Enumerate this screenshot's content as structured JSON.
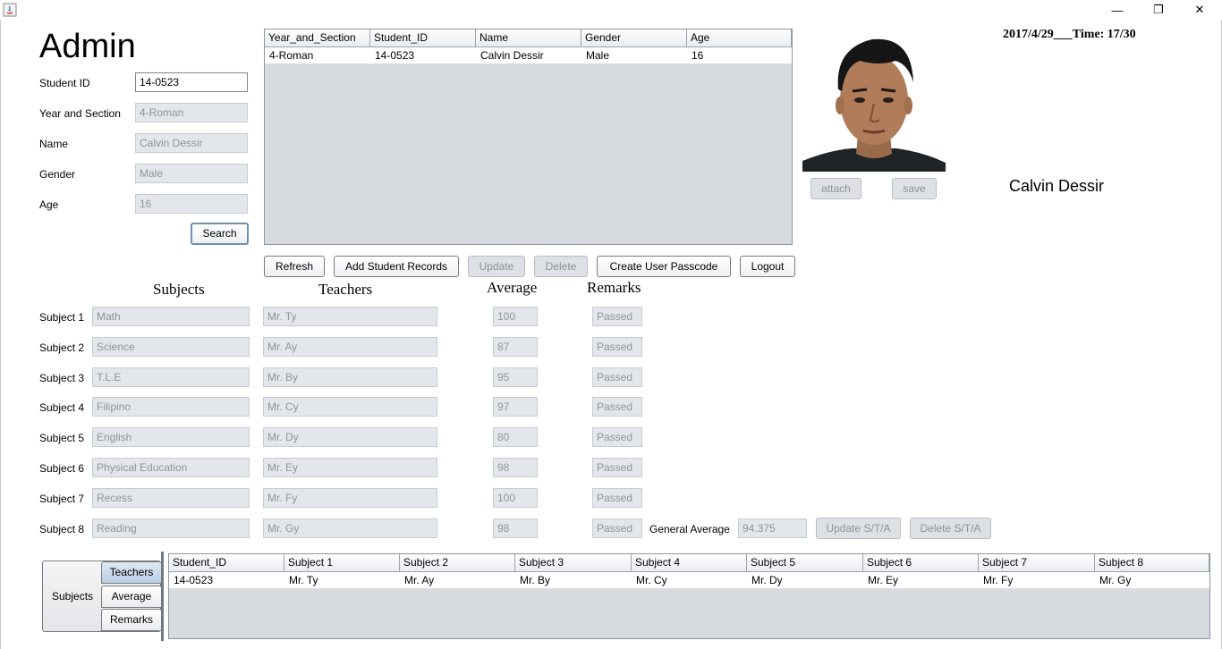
{
  "window": {
    "minimize": "—",
    "restore": "❐",
    "close": "✕"
  },
  "header": {
    "title": "Admin",
    "datetime": "2017/4/29___Time: 17/30"
  },
  "form": {
    "student_id_label": "Student ID",
    "student_id_value": "14-0523",
    "year_section_label": "Year and Section",
    "year_section_value": "4-Roman",
    "name_label": "Name",
    "name_value": "Calvin Dessir",
    "gender_label": "Gender",
    "gender_value": "Male",
    "age_label": "Age",
    "age_value": "16",
    "search_label": "Search"
  },
  "students_table": {
    "columns": [
      "Year_and_Section",
      "Student_ID",
      "Name",
      "Gender",
      "Age"
    ],
    "rows": [
      [
        "4-Roman",
        "14-0523",
        "Calvin Dessir",
        "Male",
        "16"
      ]
    ]
  },
  "actions": {
    "refresh": "Refresh",
    "add": "Add Student Records",
    "update": "Update",
    "delete": "Delete",
    "passcode": "Create User Passcode",
    "logout": "Logout"
  },
  "photo": {
    "attach": "attach",
    "save": "save",
    "student_name": "Calvin Dessir"
  },
  "grades": {
    "headers": {
      "subjects": "Subjects",
      "teachers": "Teachers",
      "average": "Average",
      "remarks": "Remarks"
    },
    "rows": [
      {
        "label": "Subject 1",
        "subject": "Math",
        "teacher": "Mr. Ty",
        "average": "100",
        "remarks": "Passed"
      },
      {
        "label": "Subject 2",
        "subject": "Science",
        "teacher": "Mr. Ay",
        "average": "87",
        "remarks": "Passed"
      },
      {
        "label": "Subject 3",
        "subject": "T.L.E",
        "teacher": "Mr. By",
        "average": "95",
        "remarks": "Passed"
      },
      {
        "label": "Subject 4",
        "subject": "Filipino",
        "teacher": "Mr. Cy",
        "average": "97",
        "remarks": "Passed"
      },
      {
        "label": "Subject 5",
        "subject": "English",
        "teacher": "Mr. Dy",
        "average": "80",
        "remarks": "Passed"
      },
      {
        "label": "Subject 6",
        "subject": "Physical Education",
        "teacher": "Mr. Ey",
        "average": "98",
        "remarks": "Passed"
      },
      {
        "label": "Subject 7",
        "subject": "Recess",
        "teacher": "Mr. Fy",
        "average": "100",
        "remarks": "Passed"
      },
      {
        "label": "Subject 8",
        "subject": "Reading",
        "teacher": "Mr. Gy",
        "average": "98",
        "remarks": "Passed"
      }
    ],
    "general_average_label": "General Average",
    "general_average_value": "94.375",
    "update_sta": "Update S/T/A",
    "delete_sta": "Delete S/T/A"
  },
  "bottom_tabs": {
    "outer": "Subjects",
    "inner": [
      "Teachers",
      "Average",
      "Remarks"
    ]
  },
  "teachers_table": {
    "columns": [
      "Student_ID",
      "Subject 1",
      "Subject 2",
      "Subject 3",
      "Subject 4",
      "Subject 5",
      "Subject 6",
      "Subject 7",
      "Subject 8"
    ],
    "rows": [
      [
        "14-0523",
        "Mr. Ty",
        "Mr. Ay",
        "Mr. By",
        "Mr. Cy",
        "Mr. Dy",
        "Mr. Ey",
        "Mr. Fy",
        "Mr. Gy"
      ]
    ]
  }
}
